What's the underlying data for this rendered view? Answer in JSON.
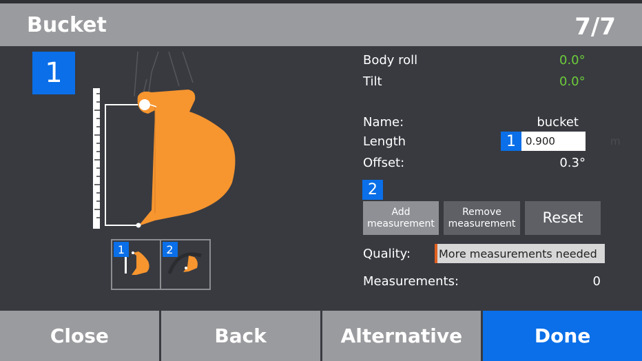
{
  "header": {
    "title": "Bucket",
    "page": "7/7"
  },
  "step_badge": "1",
  "thumbnails": [
    {
      "badge": "1"
    },
    {
      "badge": "2"
    }
  ],
  "info": {
    "body_roll_label": "Body roll",
    "body_roll_value": "0.0°",
    "tilt_label": "Tilt",
    "tilt_value": "0.0°",
    "name_label": "Name:",
    "name_value": "bucket",
    "length_label": "Length",
    "length_badge": "1",
    "length_value": "0.900",
    "length_unit": "m",
    "offset_label": "Offset:",
    "offset_value": "0.3°"
  },
  "measurement": {
    "section_badge": "2",
    "add_label": "Add measurement",
    "remove_label": "Remove measurement",
    "reset_label": "Reset",
    "quality_label": "Quality:",
    "quality_value": "More measurements needed",
    "count_label": "Measurements:",
    "count_value": "0"
  },
  "footer": {
    "close": "Close",
    "back": "Back",
    "alternative": "Alternative",
    "done": "Done"
  },
  "colors": {
    "accent": "#0a6fe8",
    "bucket": "#f7952f",
    "ok": "#6dcc3a",
    "warning": "#e06020"
  }
}
